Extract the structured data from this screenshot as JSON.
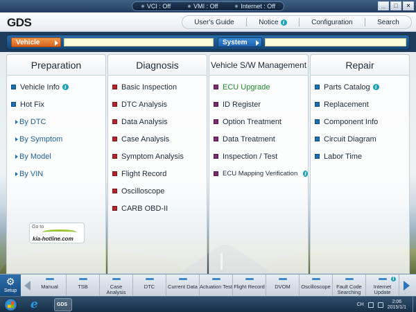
{
  "titlebar": {
    "status": [
      {
        "label": "VCI : Off"
      },
      {
        "label": "VMI : Off"
      },
      {
        "label": "Internet : Off"
      }
    ],
    "buttons": {
      "minimize": "_",
      "maximize": "□",
      "close": "×"
    }
  },
  "header": {
    "logo": "GDS",
    "menu": {
      "users_guide": "User's Guide",
      "notice": "Notice",
      "configuration": "Configuration",
      "search": "Search"
    }
  },
  "selector": {
    "vehicle_label": "Vehicle",
    "vehicle_value": "",
    "system_label": "System",
    "system_value": ""
  },
  "columns": {
    "preparation": {
      "title": "Preparation",
      "items": [
        "Vehicle Info",
        "Hot Fix",
        "By DTC",
        "By Symptom",
        "By Model",
        "By VIN"
      ]
    },
    "diagnosis": {
      "title": "Diagnosis",
      "items": [
        "Basic Inspection",
        "DTC Analysis",
        "Data Analysis",
        "Case Analysis",
        "Symptom Analysis",
        "Flight Record",
        "Oscilloscope",
        "CARB OBD-II"
      ]
    },
    "vehicle_sw": {
      "title": "Vehicle S/W Management",
      "items": [
        "ECU Upgrade",
        "ID Register",
        "Option Treatment",
        "Data Treatment",
        "Inspection / Test",
        "ECU Mapping Verification"
      ]
    },
    "repair": {
      "title": "Repair",
      "items": [
        "Parts Catalog",
        "Replacement",
        "Component Info",
        "Circuit Diagram",
        "Labor Time"
      ]
    }
  },
  "badge": {
    "goto": "Go to",
    "url": "kia-hotline.com"
  },
  "funcbar": {
    "setup": "Setup",
    "tabs": [
      "Manual",
      "TSB",
      "Case Analysis",
      "DTC",
      "Current Data",
      "Actuation Test",
      "Flight Record",
      "DVOM",
      "Oscilloscope",
      "Fault Code Searching",
      "Internet Update"
    ]
  },
  "taskbar": {
    "gds_app": "GDS",
    "lang": "CH",
    "time": "2:06",
    "date": "2015/1/1"
  },
  "colors": {
    "vehicle_button": "#d8611b",
    "system_button": "#1f62ad",
    "ecu_upgrade_text": "#1e8a2a",
    "info_icon": "#19a3b9"
  }
}
